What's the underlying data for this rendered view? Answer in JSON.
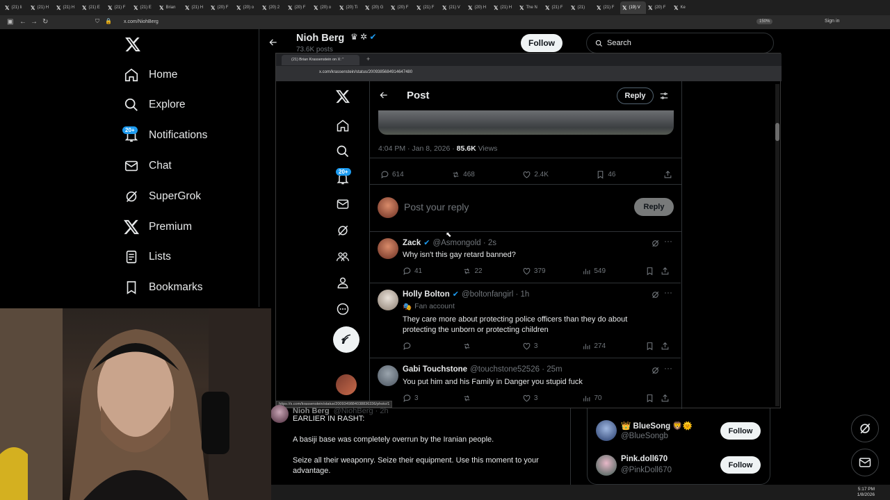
{
  "browser": {
    "tabs": [
      "(21) li",
      "(21) H",
      "(21) H",
      "(21) E",
      "(21) F",
      "(21) E",
      "Brian",
      "(21) H",
      "(20) F",
      "(20) o",
      "(20) 2",
      "(20) F",
      "(20) o",
      "(20) Ti",
      "(20) G",
      "(20) F",
      "(21) F",
      "(21) V",
      "(20) H",
      "(21) H",
      "The N",
      "(21) F",
      "(21)",
      "(21) F",
      "(19) V",
      "(20) F",
      "Ke"
    ],
    "url": "x.com/NiohBerg",
    "zoom": "150%",
    "signin": "Sign in"
  },
  "sidebar": {
    "items": [
      {
        "label": "Home",
        "icon": "home-icon"
      },
      {
        "label": "Explore",
        "icon": "search-icon"
      },
      {
        "label": "Notifications",
        "icon": "bell-icon"
      },
      {
        "label": "Chat",
        "icon": "mail-icon"
      },
      {
        "label": "SuperGrok",
        "icon": "grok-icon"
      },
      {
        "label": "Premium",
        "icon": "x-logo-icon"
      },
      {
        "label": "Lists",
        "icon": "list-icon"
      },
      {
        "label": "Bookmarks",
        "icon": "bookmark-icon"
      }
    ],
    "notif_badge": "20+"
  },
  "profile": {
    "name": "Nioh Berg",
    "posts": "73.6K posts",
    "follow": "Follow"
  },
  "search": {
    "placeholder": "Search"
  },
  "popup": {
    "tab_title": "(21) Brian Krassenstein on X: \"",
    "url": "x.com/krassenstein/status/2009385684914647480",
    "header": "Post",
    "reply_btn": "Reply",
    "meta_time": "4:04 PM · Jan 8, 2026 · ",
    "meta_views": "85.6K",
    "meta_views_label": " Views",
    "stats": {
      "replies": "614",
      "reposts": "468",
      "likes": "2.4K",
      "bookmarks": "46"
    },
    "compose_placeholder": "Post your reply",
    "compose_btn": "Reply",
    "notif_badge": "20+",
    "status_link": "https://x.com/krassenstein/status/2009349884038836336/photo/1",
    "replies": [
      {
        "name": "Zack",
        "handle": "@Asmongold · 2s",
        "text": "Why isn't this gay retard banned?",
        "sub": "",
        "r": "41",
        "rt": "22",
        "l": "379",
        "v": "549"
      },
      {
        "name": "Holly Bolton",
        "handle": "@boltonfangirl · 1h",
        "sub": "Fan account",
        "text": "They care more about protecting police officers than they do about protecting the unborn or protecting children",
        "r": "",
        "rt": "",
        "l": "3",
        "v": "274"
      },
      {
        "name": "Gabi Touchstone",
        "handle": "@touchstone52526 · 25m",
        "sub": "",
        "text": "You put him and his Family in Danger  you stupid fuck",
        "r": "3",
        "rt": "",
        "l": "3",
        "v": "70"
      }
    ]
  },
  "background_post": {
    "author": "Nioh Berg",
    "handle": "@NiohBerg · 2h",
    "p1": "EARLIER IN RASHT:",
    "p2": "A basiji base was completely overrun by the Iranian people.",
    "p3": "Seize all their weaponry. Seize their equipment. Use this moment to your advantage."
  },
  "who_to_follow": [
    {
      "name": "👑 BlueSong 🦁🌞",
      "handle": "@BlueSongb",
      "btn": "Follow"
    },
    {
      "name": "Pink.doll670",
      "handle": "@PinkDoll670",
      "btn": "Follow"
    }
  ],
  "taskbar": {
    "time": "5:17 PM",
    "date": "1/8/2026"
  },
  "colors": {
    "accent": "#1d9bf0",
    "bg": "#000000",
    "text": "#e7e9ea",
    "muted": "#71767b"
  }
}
